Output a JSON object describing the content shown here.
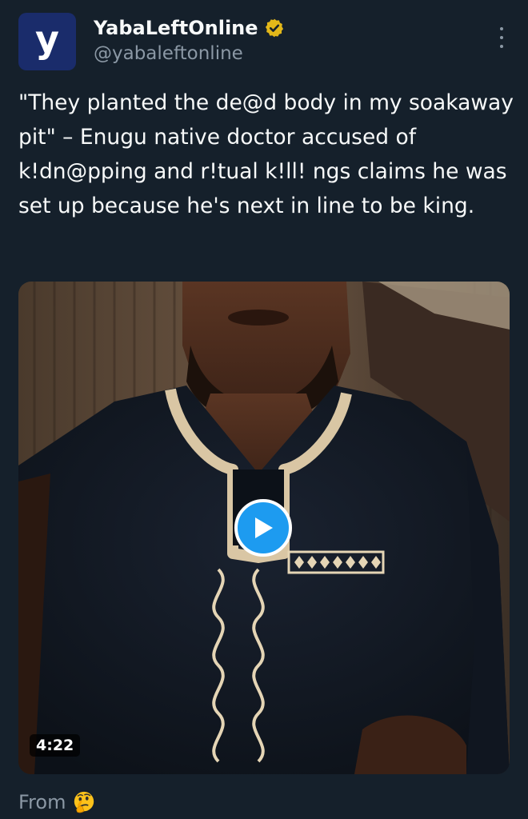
{
  "author": {
    "display_name": "YabaLeftOnline",
    "handle": "@yabaleftonline",
    "avatar_letter": "y",
    "avatar_color": "#1a2c6b",
    "verified": true,
    "verified_color": "#e2b719"
  },
  "tweet": {
    "text": "\"They planted the de@d body in my soakaway pit\" – Enugu native doctor accused of k!dn@pping and r!tual k!ll! ngs claims he was set up because he's next in line to be king."
  },
  "media": {
    "type": "video",
    "duration": "4:22",
    "play_icon": "play-icon",
    "accent": "#1d9bf0"
  },
  "footer": {
    "from_label": "From",
    "emoji": "thinking-face-icon"
  },
  "menu_icon": "more-options-icon",
  "colors": {
    "background": "#15202b",
    "text": "#f7f9f9",
    "secondary": "#8b98a5"
  }
}
